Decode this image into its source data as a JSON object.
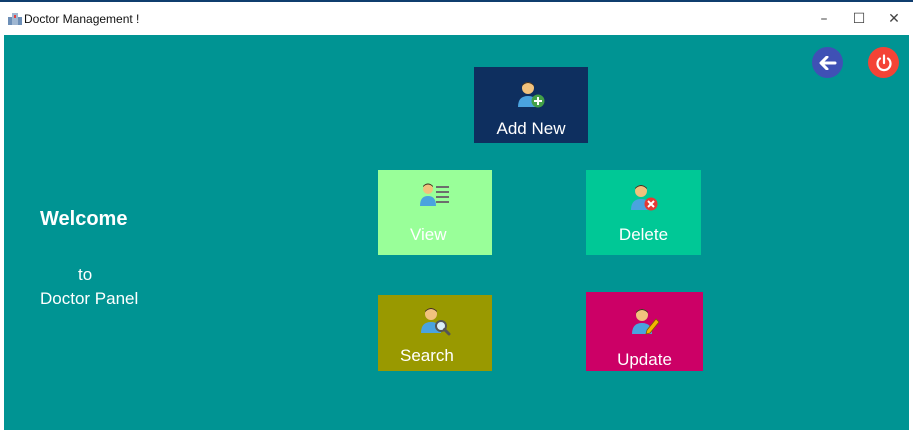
{
  "window": {
    "title": "Doctor Management !",
    "controls": {
      "minimize": "–",
      "maximize": "☐",
      "close": "✕"
    }
  },
  "header_buttons": {
    "back_icon": "arrow-left-icon",
    "power_icon": "power-icon",
    "back_color": "#3f51b5",
    "power_color": "#f44336"
  },
  "welcome": {
    "line1": "Welcome",
    "line2": "to",
    "line3": "Doctor Panel"
  },
  "tiles": {
    "add_new": {
      "label": "Add New",
      "color": "#0e2f5f",
      "icon": "doctor-add-icon"
    },
    "view": {
      "label": "View",
      "color": "#99ff99",
      "icon": "doctor-list-icon"
    },
    "delete": {
      "label": "Delete",
      "color": "#00c896",
      "icon": "doctor-remove-icon"
    },
    "search": {
      "label": "Search",
      "color": "#999900",
      "icon": "doctor-search-icon"
    },
    "update": {
      "label": "Update",
      "color": "#cc0066",
      "icon": "doctor-edit-icon"
    }
  },
  "colors": {
    "background": "#009493"
  }
}
